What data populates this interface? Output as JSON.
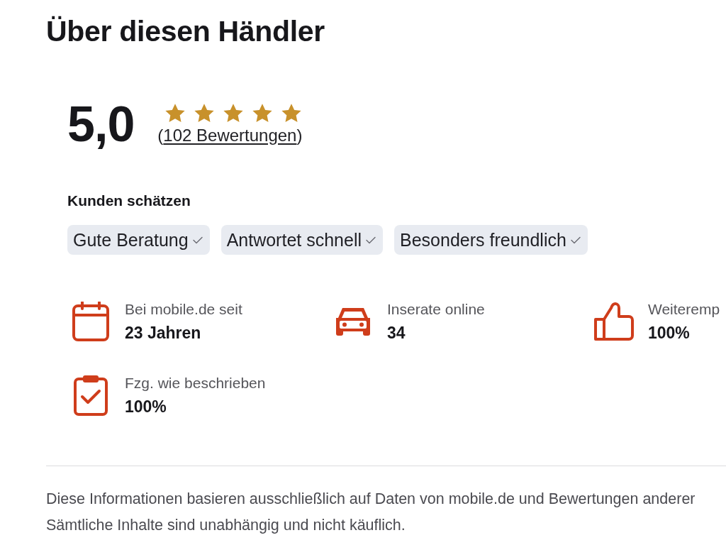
{
  "title": "Über diesen Händler",
  "rating": {
    "score": "5,0",
    "stars": 5,
    "reviews": {
      "before": "(",
      "link": "102 Bewertungen",
      "after": ")"
    }
  },
  "praise": {
    "heading": "Kunden schätzen",
    "tags": [
      "Gute Beratung",
      "Antwortet schnell",
      "Besonders freundlich"
    ]
  },
  "stats": [
    {
      "kind": "membership",
      "label": "Bei mobile.de seit",
      "value": "23 Jahren"
    },
    {
      "kind": "listings",
      "label": "Inserate online",
      "value": "34"
    },
    {
      "kind": "recommendation",
      "label": "Weiteremp",
      "value": "100%"
    },
    {
      "kind": "accuracy",
      "label": "Fzg. wie beschrieben",
      "value": "100%"
    }
  ],
  "disclaimer": [
    "Diese Informationen basieren ausschließlich auf Daten von mobile.de und Bewertungen anderer",
    "Sämtliche Inhalte sind unabhängig und nicht käuflich."
  ]
}
